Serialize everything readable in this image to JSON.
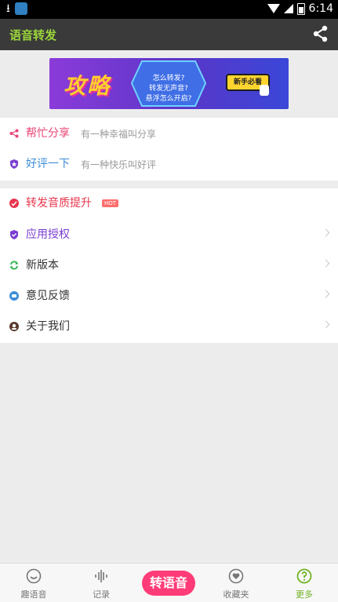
{
  "status_bar": {
    "time": "6:14",
    "download_glyph": "⭳"
  },
  "header": {
    "title": "语音转发"
  },
  "banner": {
    "headline": "攻略",
    "lines": [
      "怎么转发?",
      "转发无声音?",
      "悬浮怎么开启?"
    ],
    "button": "新手必看"
  },
  "group1": [
    {
      "icon": "share-icon",
      "label": "帮忙分享",
      "sub": "有一种幸福叫分享",
      "color": "#e94476"
    },
    {
      "icon": "shield-star-icon",
      "label": "好评一下",
      "sub": "有一种快乐叫好评",
      "color": "#3d8ed9"
    }
  ],
  "group2": [
    {
      "icon": "quality-icon",
      "label": "转发音质提升",
      "badge": "HOT",
      "color": "#e8354d"
    },
    {
      "icon": "shield-check-icon",
      "label": "应用授权",
      "color": "#7a3ed2"
    },
    {
      "icon": "refresh-icon",
      "label": "新版本",
      "color": "#333333"
    },
    {
      "icon": "feedback-icon",
      "label": "意见反馈",
      "color": "#333333"
    },
    {
      "icon": "about-icon",
      "label": "关于我们",
      "color": "#333333"
    }
  ],
  "tabs": [
    {
      "label": "趣语音",
      "icon": "smile-icon",
      "active": false
    },
    {
      "label": "记录",
      "icon": "waveform-icon",
      "active": false
    },
    {
      "label": "转语音",
      "icon": "center-button",
      "active": false
    },
    {
      "label": "收藏夹",
      "icon": "heart-icon",
      "active": false
    },
    {
      "label": "更多",
      "icon": "question-icon",
      "active": true
    }
  ],
  "colors": {
    "accent_green": "#9bd63a",
    "active_tab": "#6fb325",
    "pink": "#ff3c77"
  }
}
